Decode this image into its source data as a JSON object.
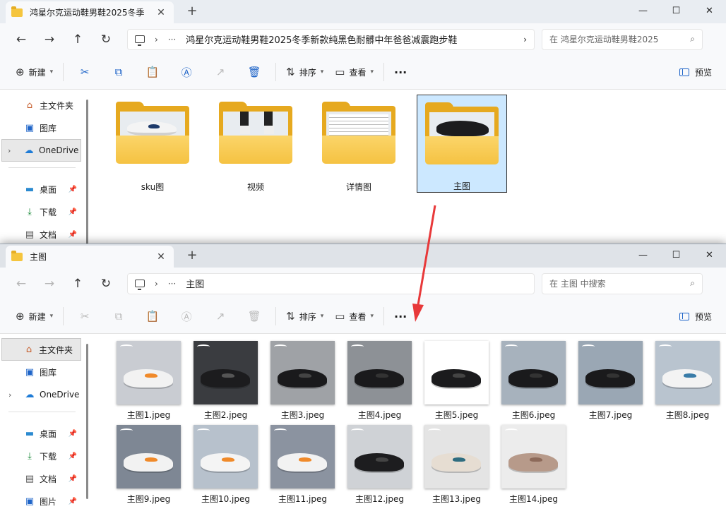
{
  "colors": {
    "accent": "#1e64c8",
    "arrow": "#e8393a",
    "folder": "#f5c242",
    "selection": "#cce8ff"
  },
  "win1": {
    "tab_title": "鸿星尔克运动鞋男鞋2025冬季",
    "address_path": "鸿星尔克运动鞋男鞋2025冬季新款纯黑色耐髒中年爸爸减震跑步鞋",
    "search_placeholder": "在 鸿星尔克运动鞋男鞋2025",
    "folders": [
      {
        "label": "sku图",
        "thumb": "white-shoe"
      },
      {
        "label": "视频",
        "thumb": "legs"
      },
      {
        "label": "详情图",
        "thumb": "table"
      },
      {
        "label": "主图",
        "thumb": "black-shoe",
        "selected": true
      }
    ]
  },
  "win2": {
    "tab_title": "主图",
    "address_path": "主图",
    "search_placeholder": "在 主图 中搜索",
    "files": [
      {
        "name": "主图1.jpeg",
        "bg": "#c9ccd2",
        "shoe": "#f2f2f2",
        "accent": "#f08a2a"
      },
      {
        "name": "主图2.jpeg",
        "bg": "#3a3c40",
        "shoe": "#1c1c1e",
        "accent": "#555"
      },
      {
        "name": "主图3.jpeg",
        "bg": "#9fa2a6",
        "shoe": "#1a1a1c",
        "accent": "#444"
      },
      {
        "name": "主图4.jpeg",
        "bg": "#8d9196",
        "shoe": "#1a1a1c",
        "accent": "#333"
      },
      {
        "name": "主图5.jpeg",
        "bg": "#ffffff",
        "shoe": "#1b1b1d",
        "accent": "#444"
      },
      {
        "name": "主图6.jpeg",
        "bg": "#a7b2bd",
        "shoe": "#1a1a1c",
        "accent": "#333"
      },
      {
        "name": "主图7.jpeg",
        "bg": "#9aa7b4",
        "shoe": "#1a1a1c",
        "accent": "#333"
      },
      {
        "name": "主图8.jpeg",
        "bg": "#b9c4cf",
        "shoe": "#f3f3f3",
        "accent": "#3a7ca8"
      },
      {
        "name": "主图9.jpeg",
        "bg": "#7e8794",
        "shoe": "#f2f2f2",
        "accent": "#f08a2a"
      },
      {
        "name": "主图10.jpeg",
        "bg": "#b7c1cc",
        "shoe": "#f4f4f4",
        "accent": "#f08a2a"
      },
      {
        "name": "主图11.jpeg",
        "bg": "#8b93a0",
        "shoe": "#f2f2f2",
        "accent": "#f08a2a"
      },
      {
        "name": "主图12.jpeg",
        "bg": "#cfd2d6",
        "shoe": "#1d1d1f",
        "accent": "#444"
      },
      {
        "name": "主图13.jpeg",
        "bg": "#e4e4e4",
        "shoe": "#e6ddd2",
        "accent": "#2f6d80"
      },
      {
        "name": "主图14.jpeg",
        "bg": "#ececec",
        "shoe": "#b79a8a",
        "accent": "#8d6a5a"
      }
    ]
  },
  "toolbar": {
    "new_label": "新建",
    "sort_label": "排序",
    "view_label": "查看",
    "more_label": "···",
    "preview_label": "预览"
  },
  "sidebar": {
    "home": "主文件夹",
    "gallery": "图库",
    "onedrive": "OneDrive",
    "desktop": "桌面",
    "downloads": "下载",
    "documents": "文档",
    "pictures": "图片"
  },
  "icons": {
    "back": "←",
    "forward": "→",
    "up": "↑",
    "refresh": "↻",
    "close": "✕",
    "add": "+",
    "minimize": "—",
    "maximize": "☐",
    "more_path": "···",
    "chevron_right": "›",
    "search": "⌕"
  }
}
